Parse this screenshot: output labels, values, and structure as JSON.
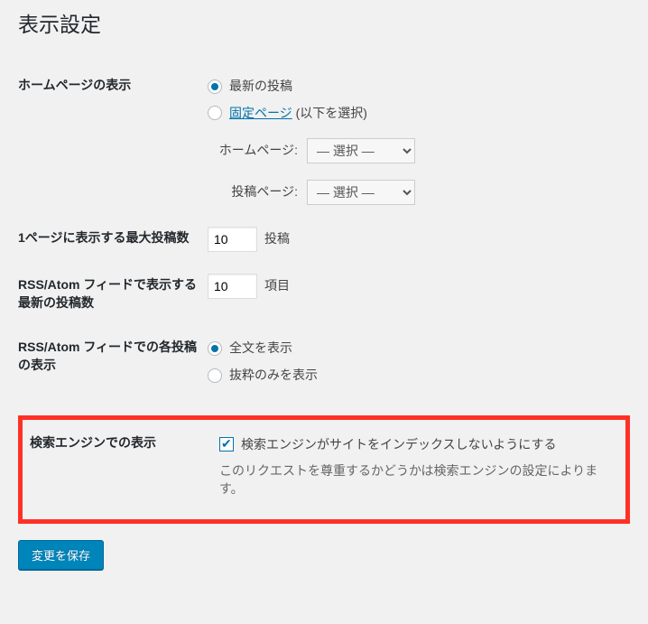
{
  "page_title": "表示設定",
  "homepage_display": {
    "label": "ホームページの表示",
    "options": {
      "latest": "最新の投稿",
      "static_link": "固定ページ",
      "static_suffix": " (以下を選択)"
    },
    "subfields": {
      "homepage_label": "ホームページ:",
      "posts_page_label": "投稿ページ:",
      "select_placeholder": "— 選択 —"
    }
  },
  "posts_per_page": {
    "label": "1ページに表示する最大投稿数",
    "value": "10",
    "unit": "投稿"
  },
  "rss_items": {
    "label": "RSS/Atom フィードで表示する最新の投稿数",
    "value": "10",
    "unit": "項目"
  },
  "feed_content": {
    "label": "RSS/Atom フィードでの各投稿の表示",
    "options": {
      "full": "全文を表示",
      "summary": "抜粋のみを表示"
    }
  },
  "search_engine": {
    "label": "検索エンジンでの表示",
    "checkbox_label": "検索エンジンがサイトをインデックスしないようにする",
    "description": "このリクエストを尊重するかどうかは検索エンジンの設定によります。"
  },
  "save_button": "変更を保存"
}
